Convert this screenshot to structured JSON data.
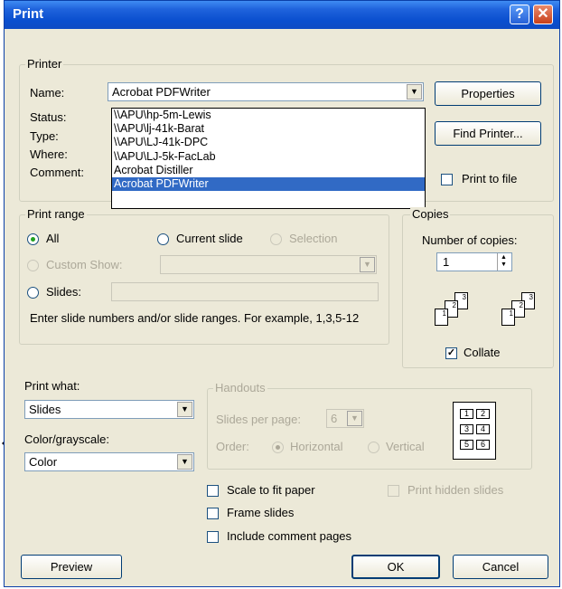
{
  "window": {
    "title": "Print",
    "help_glyph": "?",
    "close_glyph": "✕"
  },
  "printer": {
    "group_label": "Printer",
    "name_label": "Name:",
    "name_value": "Acrobat PDFWriter",
    "status_label": "Status:",
    "type_label": "Type:",
    "where_label": "Where:",
    "comment_label": "Comment:",
    "properties_button": "Properties",
    "find_printer_button": "Find Printer...",
    "print_to_file_label": "Print to file",
    "print_to_file_checked": false,
    "dropdown_items": [
      "\\\\APU\\hp-5m-Lewis",
      "\\\\APU\\lj-41k-Barat",
      "\\\\APU\\LJ-41k-DPC",
      "\\\\APU\\LJ-5k-FacLab",
      "Acrobat Distiller",
      "Acrobat PDFWriter"
    ],
    "selected_index": 5
  },
  "print_range": {
    "group_label": "Print range",
    "all_label": "All",
    "current_slide_label": "Current slide",
    "selection_label": "Selection",
    "custom_show_label": "Custom Show:",
    "slides_label": "Slides:",
    "slides_value": "",
    "hint": "Enter slide numbers and/or slide ranges. For example, 1,3,5-12",
    "selected": "All"
  },
  "copies": {
    "group_label": "Copies",
    "number_label": "Number of copies:",
    "number_value": "1",
    "collate_label": "Collate",
    "collate_checked": true,
    "stack_pages": [
      "1",
      "2",
      "3"
    ]
  },
  "print_what": {
    "label": "Print what:",
    "value": "Slides"
  },
  "color": {
    "label": "Color/grayscale:",
    "value": "Color"
  },
  "handouts": {
    "group_label": "Handouts",
    "slides_per_page_label": "Slides per page:",
    "slides_per_page_value": "6",
    "order_label": "Order:",
    "horizontal_label": "Horizontal",
    "vertical_label": "Vertical",
    "preview_cells": [
      "1",
      "2",
      "3",
      "4",
      "5",
      "6"
    ]
  },
  "options": {
    "scale_to_fit": "Scale to fit paper",
    "frame_slides": "Frame slides",
    "include_comment_pages": "Include comment pages",
    "print_hidden_slides": "Print hidden slides"
  },
  "buttons": {
    "preview": "Preview",
    "ok": "OK",
    "cancel": "Cancel"
  }
}
